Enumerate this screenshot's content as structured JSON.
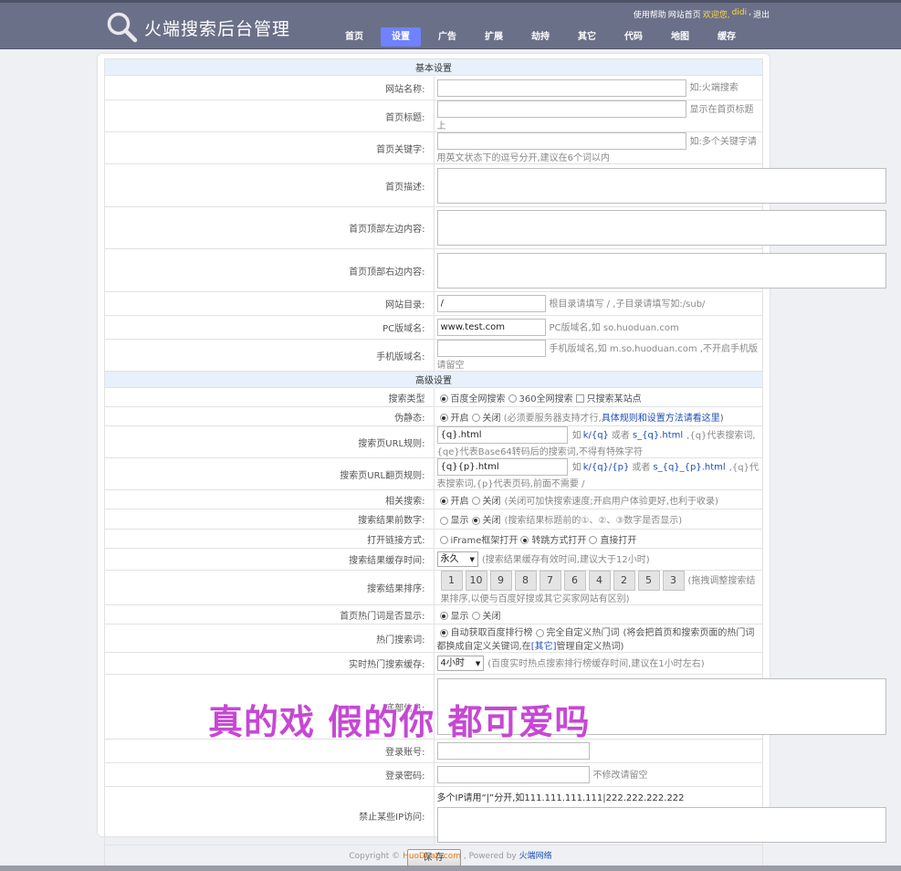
{
  "header": {
    "logo_text": "火端搜索后台管理",
    "help": "使用帮助",
    "site_home": "网站首页",
    "welcome": "欢迎您,",
    "username": "didi",
    "sep": ",",
    "logout": "退出",
    "nav": [
      "首页",
      "设置",
      "广告",
      "扩展",
      "劫持",
      "其它",
      "代码",
      "地图",
      "缓存"
    ],
    "active_nav": "设置"
  },
  "basic": {
    "title": "基本设置",
    "site_name": {
      "label": "网站名称:",
      "value": "",
      "hint": "如:火端搜索"
    },
    "home_title": {
      "label": "首页标题:",
      "value": "",
      "hint": "显示在首页标题上"
    },
    "home_keywords": {
      "label": "首页关键字:",
      "value": "",
      "hint": "如:多个关键字请用英文状态下的逗号分开,建议在6个词以内"
    },
    "home_desc": {
      "label": "首页描述:"
    },
    "top_left": {
      "label": "首页顶部左边内容:"
    },
    "top_right": {
      "label": "首页顶部右边内容:"
    },
    "site_dir": {
      "label": "网站目录:",
      "value": "/",
      "hint": "根目录请填写 / ,子目录请填写如:/sub/"
    },
    "pc_domain": {
      "label": "PC版域名:",
      "value": "www.test.com",
      "hint": "PC版域名,如 so.huoduan.com"
    },
    "mobile_domain": {
      "label": "手机版域名:",
      "value": "",
      "hint": "手机版域名,如 m.so.huoduan.com ,不开启手机版请留空"
    }
  },
  "advanced": {
    "title": "高级设置",
    "search_type": {
      "label": "搜索类型",
      "opt1": "百度全网搜索",
      "opt2": "360全网搜索",
      "opt3": "只搜索某站点"
    },
    "pseudo_static": {
      "label": "伪静态:",
      "on": "开启",
      "off": "关闭",
      "hint": "(必须要服务器支持才行,",
      "link": "具体规则和设置方法请看这里",
      "end": ")"
    },
    "search_url": {
      "label": "搜索页URL规则:",
      "value": "{q}.html",
      "p1": "如",
      "e1": "k/{q}",
      "p2": "或者",
      "e2": "s_{q}.html",
      "p3": ",{q}代表搜索词,{qe}代表Base64转码后的搜索词,不得有特殊字符"
    },
    "page_url": {
      "label": "搜索页URL翻页规则:",
      "value": "{q}{p}.html",
      "p1": "如",
      "e1": "k/{q}/{p}",
      "p2": "或者",
      "e2": "s_{q}_{p}.html",
      "p3": ",{q}代表搜索词,{p}代表页码,前面不需要 /"
    },
    "related": {
      "label": "相关搜索:",
      "on": "开启",
      "off": "关闭",
      "hint": "(关闭可加快搜索速度;开启用户体验更好,也利于收录)"
    },
    "result_num": {
      "label": "搜索结果前数字:",
      "show": "显示",
      "off": "关闭",
      "hint": "(搜索结果标题前的①、②、③数字是否显示)"
    },
    "open_mode": {
      "label": "打开链接方式:",
      "o1": "iFrame框架打开",
      "o2": "转跳方式打开",
      "o3": "直接打开"
    },
    "cache_time": {
      "label": "搜索结果缓存时间:",
      "value": "永久",
      "hint": "(搜索结果缓存有效时间,建议大于12小时)"
    },
    "sort": {
      "label": "搜索结果排序:",
      "items": [
        "1",
        "10",
        "9",
        "8",
        "7",
        "6",
        "4",
        "2",
        "5",
        "3"
      ],
      "hint": "(拖拽调整搜索结果排序,以便与百度好搜或其它买家网站有区别)"
    },
    "hot_show": {
      "label": "首页热门词是否显示:",
      "show": "显示",
      "off": "关闭"
    },
    "hot_words": {
      "label": "热门搜索词:",
      "o1": "自动获取百度排行榜",
      "o2": "完全自定义热门词",
      "hint": "(将会把首页和搜索页面的热门词都换成自定义关键词,在",
      "link": "[其它]",
      "end": "管理自定义热词)"
    },
    "realtime_cache": {
      "label": "实时热门搜索缓存:",
      "value": "4小时",
      "hint": "(百度实时热点搜索排行榜缓存时间,建议在1小时左右)"
    },
    "footer_info": {
      "label": "底部信息:"
    },
    "login_account": {
      "label": "登录账号:",
      "value": ""
    },
    "login_password": {
      "label": "登录密码:",
      "value": "",
      "hint": "不修改请留空"
    },
    "block_ip": {
      "label": "禁止某些IP访问:",
      "hint": "多个IP请用“|”分开,如111.111.111.111|222.222.222.222"
    },
    "save": "保 存"
  },
  "overlay_text": "真的戏 假的你 都可爱吗",
  "footer": {
    "copy": "Copyright ©",
    "site": "HuoDuan.com",
    "powered": ", Powered by",
    "brand": "火端网络"
  }
}
